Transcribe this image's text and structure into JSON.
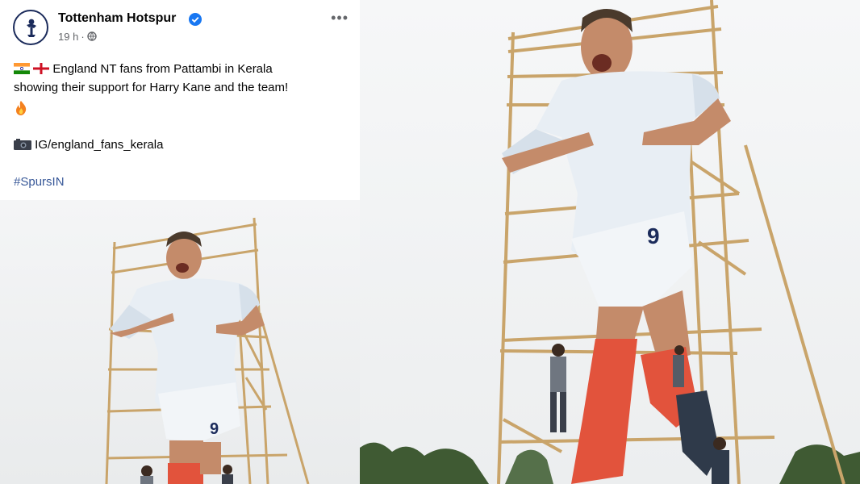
{
  "post": {
    "page_name": "Tottenham Hotspur",
    "timestamp": "19 h",
    "more_label": "•••",
    "text_line1": "England NT fans from Pattambi in Kerala",
    "text_line2": "showing their support for Harry Kane and the team!",
    "source": "IG/england_fans_kerala",
    "hashtag": "#SpursIN",
    "shirt_number": "9"
  },
  "colors": {
    "name": "#050505",
    "meta": "#65676b",
    "verified": "#1877f2",
    "hashtag": "#385898",
    "kit_white": "#e8eef4",
    "sock_red": "#e2533c",
    "scaffold": "#c9a46a"
  },
  "icons": {
    "avatar": "cockerel-crest-icon",
    "verified": "verified-badge-icon",
    "privacy": "globe-icon",
    "flags": [
      "india-flag-icon",
      "england-flag-icon"
    ],
    "emoji": "fire-icon",
    "source": "camera-icon"
  }
}
